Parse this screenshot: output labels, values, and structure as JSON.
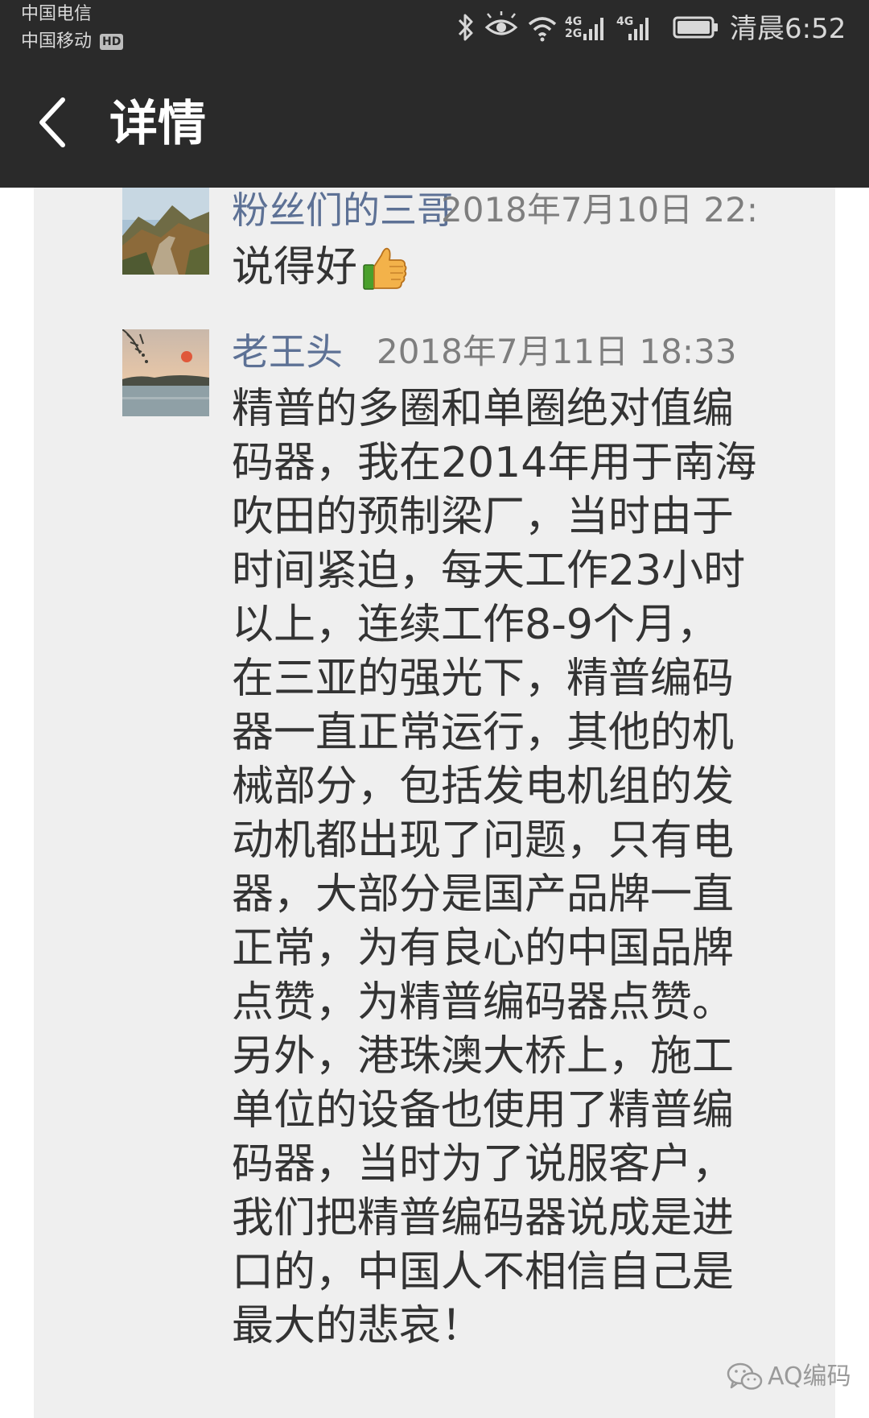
{
  "status_bar": {
    "carrier_1": "中国电信",
    "carrier_2": "中国移动",
    "hd_badge": "HD",
    "net_1_top": "4G",
    "net_1_bottom": "2G",
    "net_2": "4G",
    "clock": "清晨6:52",
    "icons": [
      "bluetooth-icon",
      "eye-icon",
      "wifi-icon",
      "signal-icon",
      "signal-icon",
      "battery-icon"
    ]
  },
  "header": {
    "back_icon": "chevron-left-icon",
    "title": "详情",
    "background": "#2a2a2a"
  },
  "comments": [
    {
      "nickname": "粉丝们的三哥",
      "timestamp": "2018年7月10日 22:",
      "text": "说得好",
      "emoji": "thumbs-up-icon",
      "avatar": "mountain-great-wall-photo"
    },
    {
      "nickname": "老王头",
      "timestamp": "2018年7月11日 18:33",
      "text": "精普的多圈和单圈绝对值编\n码器，我在2014年用于南海\n吹田的预制梁厂，当时由于\n时间紧迫，每天工作23小时\n以上，连续工作8-9个月，\n在三亚的强光下，精普编码\n器一直正常运行，其他的机\n械部分，包括发电机组的发\n动机都出现了问题，只有电\n器，大部分是国产品牌一直\n正常，为有良心的中国品牌\n点赞，为精普编码器点赞。\n另外，港珠澳大桥上，施工\n单位的设备也使用了精普编\n码器，当时为了说服客户，\n我们把精普编码器说成是进\n口的，中国人不相信自己是\n最大的悲哀！",
      "avatar": "sunset-lake-photo"
    }
  ],
  "watermark": {
    "icon": "wechat-icon",
    "text": "AQ编码"
  },
  "colors": {
    "nickname": "#5d7195",
    "timestamp": "#7e7e7e",
    "body_text": "#333333",
    "content_bg": "#efefef"
  }
}
